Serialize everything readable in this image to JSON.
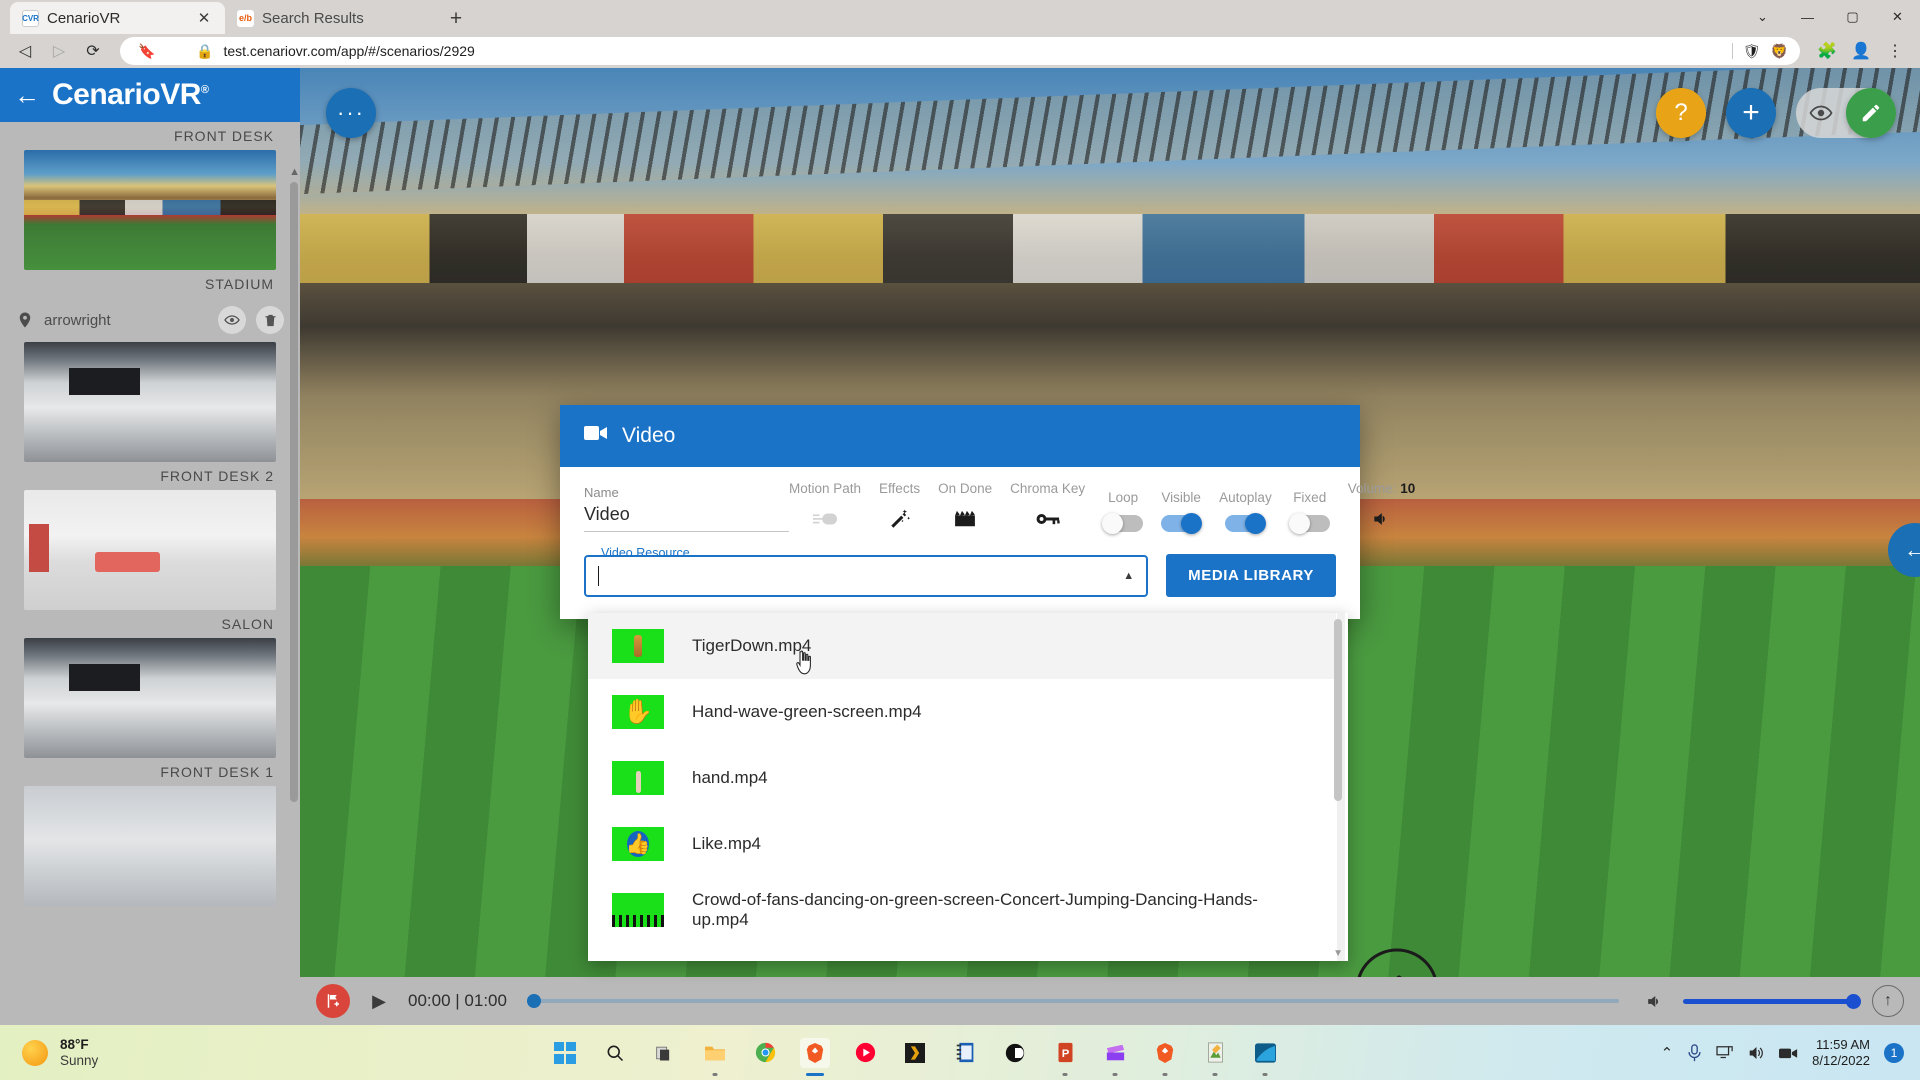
{
  "browser": {
    "tabs": [
      {
        "title": "CenarioVR",
        "favicon": "cenariovr-icon",
        "active": true,
        "close_label": "✕"
      },
      {
        "title": "Search Results",
        "favicon": "elb-icon",
        "active": false,
        "close_label": ""
      }
    ],
    "new_tab_label": "+",
    "window_controls": {
      "minimize": "—",
      "maximize": "▢",
      "close": "✕",
      "chevron": "⌄"
    },
    "nav": {
      "back": "◁",
      "forward": "▷",
      "reload": "⟳",
      "bookmark": "🔖",
      "lock": "🔒"
    },
    "url": "test.cenariovr.com/app/#/scenarios/2929",
    "omnibox_right": {
      "shield": "🛡",
      "brave": "🦁",
      "extensions": "🧩",
      "profile": "👤",
      "menu": "⋮"
    }
  },
  "sidebar": {
    "back_label": "←",
    "brand": "Cenario",
    "brand_accent": "VR",
    "brand_reg": "®",
    "top_caption": "FRONT DESK",
    "scenes": [
      {
        "caption": "STADIUM",
        "thumb": "t-stadium"
      },
      {
        "caption": "FRONT DESK 2",
        "thumb": "t-frontdesk"
      },
      {
        "caption": "SALON",
        "thumb": "t-salon"
      },
      {
        "caption": "FRONT DESK 1",
        "thumb": "t-frontdesk"
      },
      {
        "caption": "",
        "thumb": "t-office"
      }
    ],
    "poi": {
      "label": "arrowright",
      "pin_icon": "location-pin-icon",
      "eye_icon": "eye-icon",
      "trash_icon": "trash-icon"
    }
  },
  "viewer": {
    "menu_button": "···",
    "tools": [
      {
        "name": "help-button",
        "glyph": "?"
      },
      {
        "name": "add-button",
        "glyph": "+"
      },
      {
        "name": "preview-eye-button",
        "glyph": "👁"
      },
      {
        "name": "edit-pencil-button",
        "glyph": "✎"
      }
    ],
    "panel_collapse": "←"
  },
  "playbar": {
    "flag_icon": "add-flag-icon",
    "play_icon": "▶",
    "time": "00:00 | 01:00",
    "volume_icon": "🔊",
    "expand_icon": "↑"
  },
  "modal": {
    "header_icon": "video-camera-icon",
    "title": "Video",
    "name_label": "Name",
    "name_value": "Video",
    "options": [
      {
        "label": "Motion Path",
        "type": "icon",
        "icon": "motion-path-icon",
        "glyph": "⊷",
        "muted": true
      },
      {
        "label": "Effects",
        "type": "icon",
        "icon": "magic-wand-icon",
        "glyph": "🪄",
        "muted": false
      },
      {
        "label": "On Done",
        "type": "icon",
        "icon": "clapperboard-icon",
        "glyph": "🎬",
        "muted": false
      },
      {
        "label": "Chroma Key",
        "type": "icon",
        "icon": "key-icon",
        "glyph": "🔑",
        "muted": false
      },
      {
        "label": "Loop",
        "type": "toggle",
        "state": "off"
      },
      {
        "label": "Visible",
        "type": "toggle",
        "state": "on"
      },
      {
        "label": "Autoplay",
        "type": "toggle",
        "state": "on"
      },
      {
        "label": "Fixed",
        "type": "toggle",
        "state": "off"
      }
    ],
    "volume": {
      "label": "Volume:",
      "value": "10",
      "icon": "speaker-icon",
      "glyph": "🔊"
    },
    "resource": {
      "legend": "Video Resource",
      "value": "",
      "placeholder": "",
      "caret_icon": "▲"
    },
    "media_library_button": "MEDIA LIBRARY"
  },
  "dropdown": {
    "items": [
      {
        "name": "TigerDown.mp4",
        "thumb": "gs-tiger",
        "hover": true
      },
      {
        "name": "Hand-wave-green-screen.mp4",
        "thumb": "gs-hand-dark",
        "hover": false
      },
      {
        "name": "hand.mp4",
        "thumb": "gs-hand-light",
        "hover": false
      },
      {
        "name": "Like.mp4",
        "thumb": "gs-like",
        "hover": false
      },
      {
        "name": "Crowd-of-fans-dancing-on-green-screen-Concert-Jumping-Dancing-Hands-up.mp4",
        "thumb": "gs-crowd",
        "hover": false
      }
    ],
    "scroll_up": "▲",
    "scroll_down": "▼"
  },
  "taskbar": {
    "weather": {
      "temp": "88°F",
      "condition": "Sunny",
      "icon": "sun-icon"
    },
    "apps": [
      {
        "name": "start-button",
        "glyph": ""
      },
      {
        "name": "search-icon",
        "glyph": "🔍"
      },
      {
        "name": "task-view-icon",
        "glyph": "▤"
      },
      {
        "name": "file-explorer-icon",
        "glyph": "📁"
      },
      {
        "name": "chrome-icon",
        "glyph": "◉"
      },
      {
        "name": "brave-browser-icon",
        "glyph": "🦁"
      },
      {
        "name": "youtube-music-icon",
        "glyph": "▶"
      },
      {
        "name": "plex-icon",
        "glyph": "❯"
      },
      {
        "name": "notebook-icon",
        "glyph": "📓"
      },
      {
        "name": "lectora-icon",
        "glyph": "◕"
      },
      {
        "name": "powerpoint-icon",
        "glyph": "P"
      },
      {
        "name": "clipchamp-icon",
        "glyph": "🎞"
      },
      {
        "name": "brave-beta-icon",
        "glyph": "🦁"
      },
      {
        "name": "snagit-editor-icon",
        "glyph": "✎"
      },
      {
        "name": "camtasia-icon",
        "glyph": "◣"
      }
    ],
    "tray": {
      "chevron": "⌃",
      "mic": "🎙",
      "network": "🖥",
      "volume": "🔊",
      "camera": "📷"
    },
    "clock": {
      "time": "11:59 AM",
      "date": "8/12/2022"
    },
    "notification_count": "1"
  },
  "colors": {
    "brand_blue": "#1a73c7",
    "toggle_on": "#1a73c7",
    "green_screen": "#19e019",
    "help_orange": "#e8a317",
    "edit_green": "#3a9e4a",
    "flag_red": "#d9453a"
  }
}
